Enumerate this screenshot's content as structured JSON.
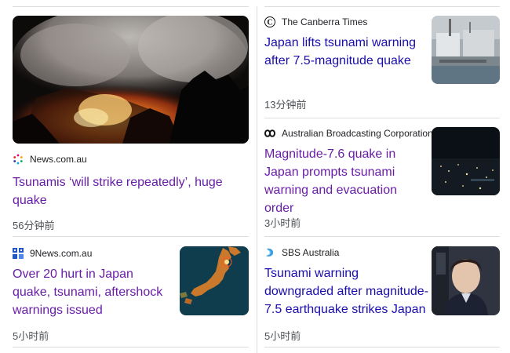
{
  "cards": [
    {
      "source": "News.com.au",
      "source_icon": "dotted-circle-icon",
      "headline": "Tsunamis ‘will strike repeatedly’, huge quake",
      "time": "56分钟前",
      "visited": true
    },
    {
      "source": "9News.com.au",
      "source_icon": "9news-logo-icon",
      "headline": "Over 20 hurt in Japan quake, tsunami, aftershock warnings issued",
      "time": "5小时前",
      "visited": true
    },
    {
      "source": "The Canberra Times",
      "source_icon": "canberra-times-logo-icon",
      "headline": "Japan lifts tsunami warning after 7.5-magnitude quake",
      "time": "13分钟前",
      "visited": false
    },
    {
      "source": "Australian Broadcasting Corporation",
      "source_icon": "abc-logo-icon",
      "headline": "Magnitude-7.6 quake in Japan prompts tsunami warning and evacuation order",
      "time": "3小时前",
      "visited": true
    },
    {
      "source": "SBS Australia",
      "source_icon": "sbs-logo-icon",
      "headline": "Tsunami warning downgraded after magnitude-7.5 earthquake strikes Japan",
      "time": "5小时前",
      "visited": false
    }
  ],
  "colors": {
    "visited_link": "#681da8",
    "unvisited_link": "#1a0dab",
    "meta_text": "#4d5156",
    "divider": "#dadce0"
  }
}
